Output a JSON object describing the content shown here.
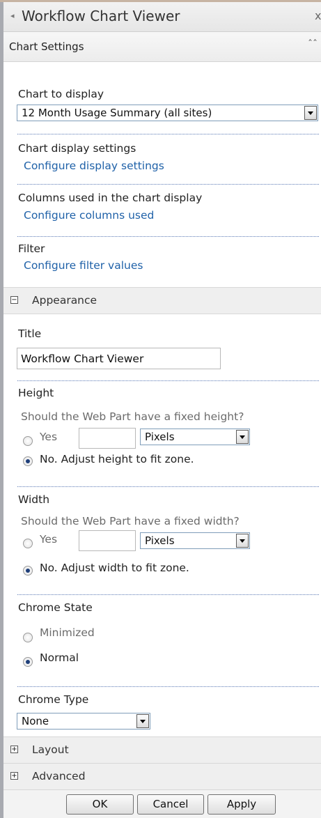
{
  "header": {
    "title": "Workflow Chart Viewer",
    "back_icon": "◂",
    "close_icon": "x"
  },
  "chart_settings": {
    "label": "Chart Settings",
    "collapse_icon": "⌃⌃",
    "chart_to_display_label": "Chart to display",
    "chart_to_display_value": "12 Month Usage Summary (all sites)",
    "display_settings_label": "Chart display settings",
    "display_settings_link": "Configure display settings",
    "columns_label": "Columns used in the chart display",
    "columns_link": "Configure columns used",
    "filter_label": "Filter",
    "filter_link": "Configure filter values"
  },
  "appearance": {
    "label": "Appearance",
    "toggle": "−",
    "title_label": "Title",
    "title_value": "Workflow Chart Viewer",
    "height": {
      "label": "Height",
      "question": "Should the Web Part have a fixed height?",
      "yes": "Yes",
      "unit": "Pixels",
      "no": "No. Adjust height to fit zone.",
      "selected": "no"
    },
    "width": {
      "label": "Width",
      "question": "Should the Web Part have a fixed width?",
      "yes": "Yes",
      "unit": "Pixels",
      "no": "No. Adjust width to fit zone.",
      "selected": "no"
    },
    "chrome_state": {
      "label": "Chrome State",
      "options": [
        "Minimized",
        "Normal"
      ],
      "selected": "Normal"
    },
    "chrome_type": {
      "label": "Chrome Type",
      "value": "None"
    }
  },
  "layout": {
    "label": "Layout",
    "toggle": "+"
  },
  "advanced": {
    "label": "Advanced",
    "toggle": "+"
  },
  "buttons": {
    "ok": "OK",
    "cancel": "Cancel",
    "apply": "Apply"
  },
  "colors": {
    "link": "#1f61a8",
    "separator": "#5b79b5",
    "radio_selected": "#1f3f7a"
  }
}
